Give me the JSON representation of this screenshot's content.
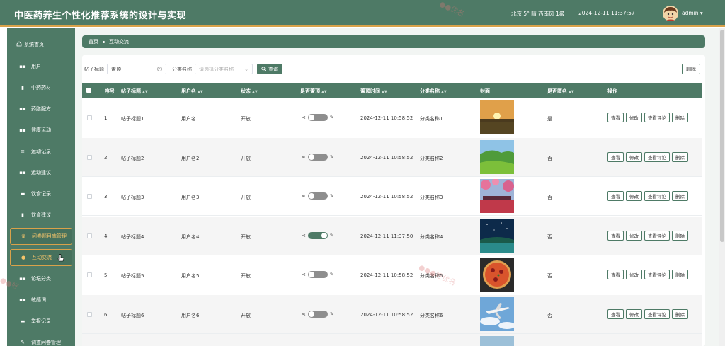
{
  "header": {
    "title": "中医药养生个性化推荐系统的设计与实现",
    "weather": "北京  5°  晴  西南风  1级",
    "datetime": "2024-12-11 11:37:57",
    "user": "admin ▾"
  },
  "sidebar": {
    "home": "系统首页",
    "items": [
      {
        "label": "用户",
        "icon": "grid-icon"
      },
      {
        "label": "中药药材",
        "icon": "bar-chart-icon"
      },
      {
        "label": "药膳配方",
        "icon": "grid-icon"
      },
      {
        "label": "健康运动",
        "icon": "grid-icon"
      },
      {
        "label": "运动记录",
        "icon": "sliders-icon"
      },
      {
        "label": "运动建议",
        "icon": "grid-icon"
      },
      {
        "label": "饮食记录",
        "icon": "tray-icon"
      },
      {
        "label": "饮食建议",
        "icon": "clipboard-icon"
      },
      {
        "label": "问卷题目库管理",
        "icon": "trophy-icon"
      },
      {
        "label": "互动交流",
        "icon": "bulb-icon"
      },
      {
        "label": "论坛分类",
        "icon": "grid-icon"
      },
      {
        "label": "敏感词",
        "icon": "grid-icon"
      },
      {
        "label": "举报记录",
        "icon": "chat-icon"
      },
      {
        "label": "调查问卷管理",
        "icon": "pen-icon"
      }
    ]
  },
  "breadcrumb": {
    "home": "首页",
    "current": "互动交流"
  },
  "search": {
    "title_label": "帖子标题",
    "title_value": "置顶",
    "category_label": "分类名称",
    "category_placeholder": "请选择分类名称",
    "search_button": "查询",
    "delete_button": "删除"
  },
  "table": {
    "headers": [
      "序号",
      "帖子标题",
      "用户名",
      "状态",
      "是否置顶",
      "置顶时间",
      "分类名称",
      "封面",
      "是否匿名",
      "操作"
    ],
    "rows": [
      {
        "index": "1",
        "title": "帖子标题1",
        "user": "用户名1",
        "status": "开放",
        "pinned": false,
        "time": "2024-12-11 10:58:52",
        "category": "分类名称1",
        "anonymous": "是",
        "cover": "sunset-field"
      },
      {
        "index": "2",
        "title": "帖子标题2",
        "user": "用户名2",
        "status": "开放",
        "pinned": false,
        "time": "2024-12-11 10:58:52",
        "category": "分类名称2",
        "anonymous": "否",
        "cover": "green-hills"
      },
      {
        "index": "3",
        "title": "帖子标题3",
        "user": "用户名3",
        "status": "开放",
        "pinned": false,
        "time": "2024-12-11 10:58:52",
        "category": "分类名称3",
        "anonymous": "否",
        "cover": "pink-blossoms"
      },
      {
        "index": "4",
        "title": "帖子标题4",
        "user": "用户名4",
        "status": "开放",
        "pinned": true,
        "time": "2024-12-11 11:37:50",
        "category": "分类名称4",
        "anonymous": "否",
        "cover": "starry-lake"
      },
      {
        "index": "5",
        "title": "帖子标题5",
        "user": "用户名5",
        "status": "开放",
        "pinned": false,
        "time": "2024-12-11 10:58:52",
        "category": "分类名称5",
        "anonymous": "否",
        "cover": "pizza"
      },
      {
        "index": "6",
        "title": "帖子标题6",
        "user": "用户名6",
        "status": "开放",
        "pinned": false,
        "time": "2024-12-11 10:58:52",
        "category": "分类名称6",
        "anonymous": "否",
        "cover": "airplane-sky"
      }
    ],
    "actions": [
      "查看",
      "修改",
      "查看评论",
      "删除"
    ]
  },
  "colors": {
    "primary": "#4e7a66",
    "accent": "#d9a24a"
  }
}
